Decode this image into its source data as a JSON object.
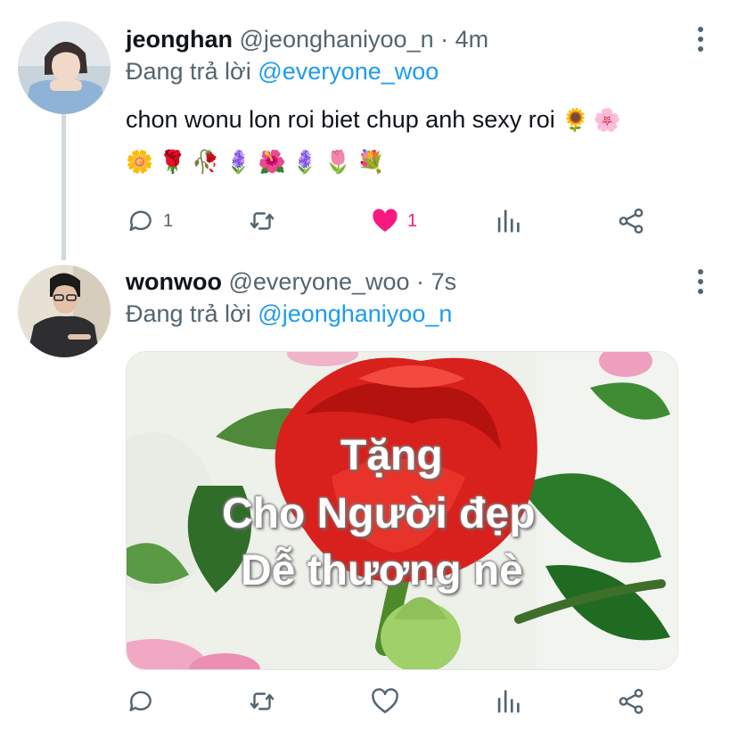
{
  "tweets": [
    {
      "name": "jeonghan",
      "handle": "@jeonghaniyoo_n",
      "dot": "·",
      "time": "4m",
      "reply_prefix": "Đang trả lời",
      "reply_to": "@everyone_woo",
      "text": "chon wonu lon roi biet chup anh sexy roi",
      "text_emojis": "🌻🌸",
      "emoji_row": "🌼🌹🥀🪻🌺🪻🌷💐",
      "actions": {
        "reply_count": "1",
        "retweet_count": "",
        "like_count": "1",
        "liked": true
      }
    },
    {
      "name": "wonwoo",
      "handle": "@everyone_woo",
      "dot": "·",
      "time": "7s",
      "reply_prefix": "Đang trả lời",
      "reply_to": "@jeonghaniyoo_n",
      "media_text": [
        "Tặng",
        "Cho Người đẹp",
        "Dễ thương nè"
      ],
      "actions": {
        "reply_count": "",
        "retweet_count": "",
        "like_count": "",
        "liked": false
      }
    }
  ],
  "icons": {
    "reply": "reply-icon",
    "retweet": "retweet-icon",
    "like": "heart-icon",
    "analytics": "analytics-icon",
    "share": "share-icon",
    "more": "more-icon"
  },
  "colors": {
    "accent": "#1d9bf0",
    "like": "#f91880",
    "muted": "#536471",
    "thread_line": "#cfd9de"
  }
}
